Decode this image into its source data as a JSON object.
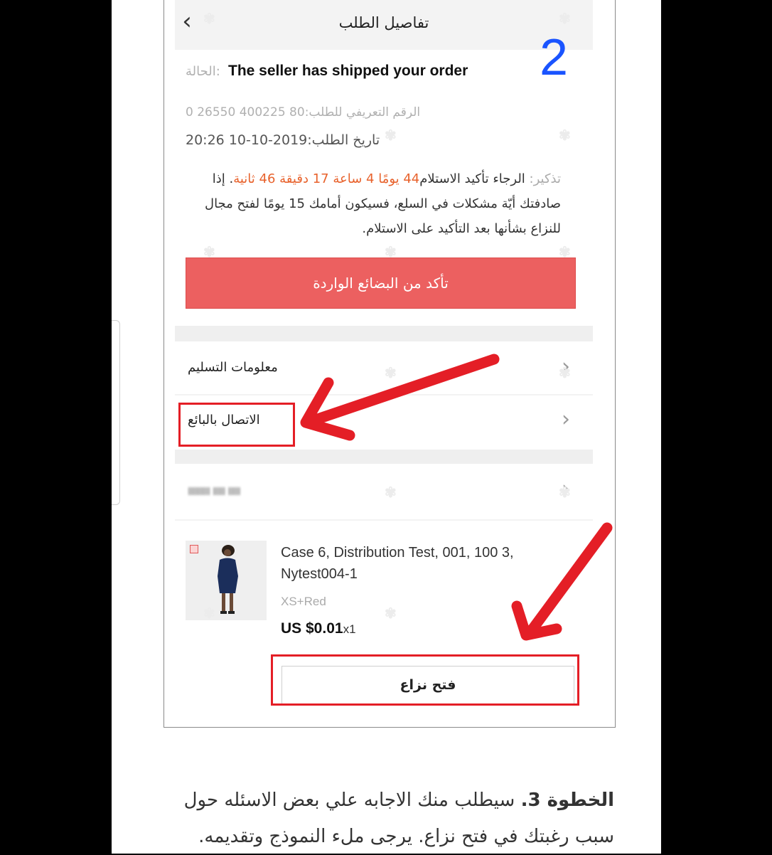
{
  "header": {
    "back_icon": "chevron-left-icon",
    "title": "تفاصيل الطلب"
  },
  "step_number": "2",
  "status": {
    "label": "الحالة:",
    "text": "The seller has shipped your order"
  },
  "order": {
    "id_text": "الرقم التعريفي للطلب:80 400225 26550 0",
    "date_text": "تاريخ الطلب:2019-10-10 20:26"
  },
  "reminder": {
    "prefix": "تذكير: ",
    "part1": "الرجاء تأكيد الاستلام",
    "countdown": "44 يومًا 4 ساعة 17 دقيقة 46 ثانية",
    "part2": ". إذا صادفتك أيّة مشكلات في السلع، فسيكون أمامك 15 يومًا لفتح مجال للنزاع بشأنها بعد التأكيد على الاستلام."
  },
  "confirm_button": "تأكد من البضائع الواردة",
  "rows": {
    "delivery_info": "معلومات التسليم",
    "contact_seller": "الاتصال بالبائع",
    "blurred": "lllllllll lllll lllll"
  },
  "product": {
    "title": "Case 6, Distribution Test, 001, 100 3, Nytest004-1",
    "variant": "XS+Red",
    "price": "US $0.01",
    "quantity": "x1"
  },
  "dispute_button": "فتح نزاع",
  "caption": {
    "step_label": "الخطوة 3.",
    "line1": " سيطلب منك الاجابه علي بعض الاسئله حول",
    "line2": "سبب رغبتك في فتح نزاع. يرجى ملء النموذج وتقديمه."
  },
  "colors": {
    "accent_red": "#ec6060",
    "arrow_red": "#e41e26",
    "step_blue": "#1a54ff",
    "countdown_orange": "#e8622c"
  }
}
